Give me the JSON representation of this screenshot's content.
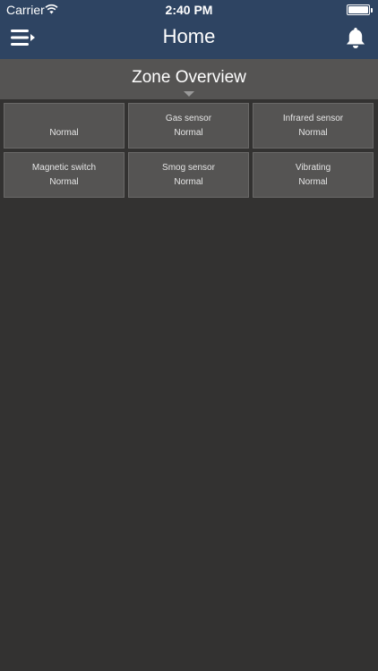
{
  "status_bar": {
    "carrier": "Carrier",
    "time": "2:40 PM",
    "wifi_icon": "wifi-icon",
    "battery_icon": "battery-icon"
  },
  "nav": {
    "title": "Home",
    "menu_icon": "menu-icon",
    "notification_icon": "bell-icon"
  },
  "section": {
    "title": "Zone Overview"
  },
  "zones": [
    {
      "name": "",
      "state": "Normal"
    },
    {
      "name": "Gas sensor",
      "state": "Normal"
    },
    {
      "name": "Infrared sensor",
      "state": "Normal"
    },
    {
      "name": "Magnetic switch",
      "state": "Normal"
    },
    {
      "name": "Smog sensor",
      "state": "Normal"
    },
    {
      "name": "Vibrating",
      "state": "Normal"
    }
  ],
  "colors": {
    "nav_background": "#2e4462",
    "page_background": "#333231",
    "tile_background": "#555453"
  }
}
